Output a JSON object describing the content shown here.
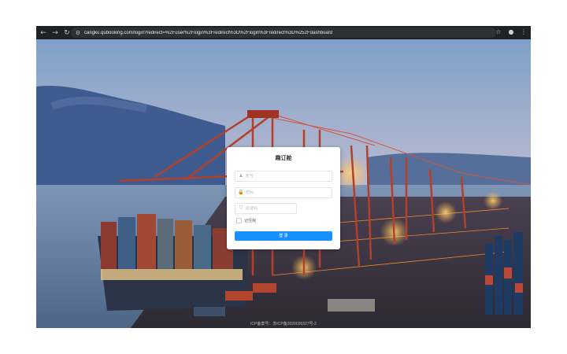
{
  "browser": {
    "url": "cangku.qubooking.com/login?redirect=%2Fuser%2Flogin%3Fredirect%3D%2Flogin%3Fredirect%3D%252Fdashboard",
    "icons": {
      "back": "arrow-left-icon",
      "forward": "arrow-right-icon",
      "reload": "reload-icon",
      "site": "site-info-icon",
      "star": "star-icon",
      "profile": "profile-icon",
      "menu": "kebab-menu-icon"
    }
  },
  "login": {
    "title": "趣订舱",
    "account_placeholder": "账号",
    "password_placeholder": "密码",
    "captcha_placeholder": "验证码",
    "remember_label": "记住我",
    "submit_label": "登 录"
  },
  "footer": {
    "icp": "ICP备案号：苏ICP备2020026327号-2"
  },
  "colors": {
    "accent": "#1890ff",
    "card": "#ffffff"
  }
}
